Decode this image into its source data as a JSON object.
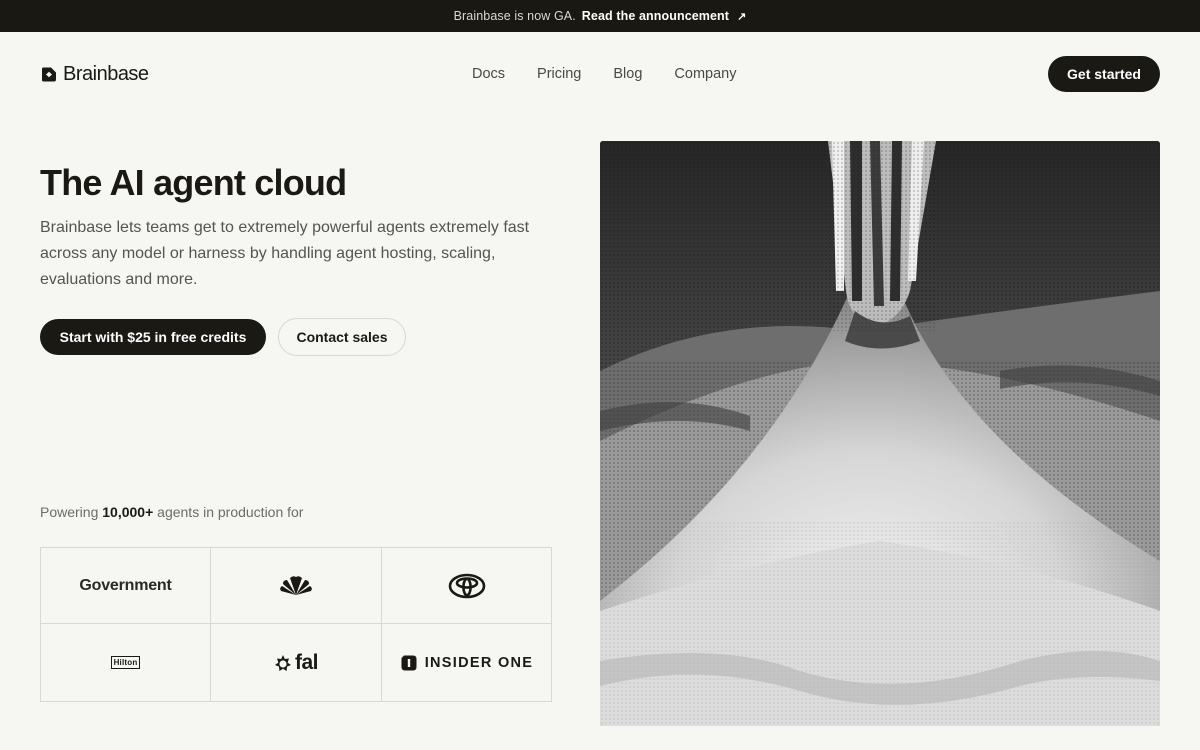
{
  "announcement": {
    "text": "Brainbase is now GA.",
    "link": "Read the announcement",
    "arrow_icon": "arrow-up-right-icon"
  },
  "nav": {
    "brand": "Brainbase",
    "links": [
      "Docs",
      "Pricing",
      "Blog",
      "Company"
    ],
    "cta": "Get started"
  },
  "hero": {
    "title": "The AI agent cloud",
    "description": "Brainbase lets teams get to extremely powerful agents extremely fast across any model or harness by handling agent hosting, scaling, evaluations and more.",
    "primary_cta": "Start with $25 in free credits",
    "secondary_cta": "Contact sales"
  },
  "customers": {
    "prefix": "Powering",
    "count": "10,000+",
    "suffix": "agents in production for",
    "logos": [
      {
        "label": "Government",
        "icon": "government-text"
      },
      {
        "label": "",
        "icon": "nbc-peacock-icon"
      },
      {
        "label": "",
        "icon": "toyota-logo-icon"
      },
      {
        "label": "Hilton",
        "icon": "hilton-logo"
      },
      {
        "label": "fal",
        "icon": "fal-logo-icon"
      },
      {
        "label": "INSIDER ONE",
        "icon": "insider-one-logo-icon"
      }
    ]
  },
  "colors": {
    "background": "#f6f6f2",
    "dark": "#1a1914",
    "topbar": "#191812",
    "border": "#d9d8d2"
  }
}
